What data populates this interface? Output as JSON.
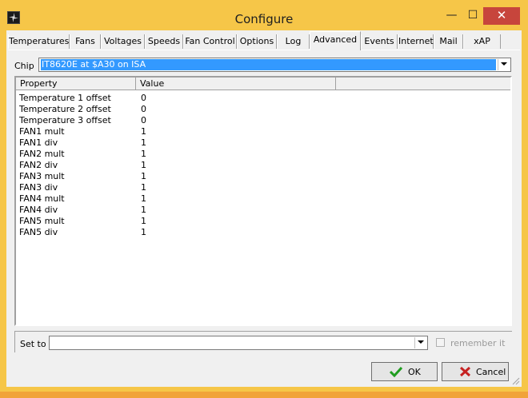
{
  "window": {
    "title": "Configure"
  },
  "caption_buttons": {
    "minimize": "—",
    "maximize": "☐",
    "close": "✕"
  },
  "tabs": [
    {
      "label": "Temperatures",
      "active": false
    },
    {
      "label": "Fans",
      "active": false
    },
    {
      "label": "Voltages",
      "active": false
    },
    {
      "label": "Speeds",
      "active": false
    },
    {
      "label": "Fan Control",
      "active": false
    },
    {
      "label": "Options",
      "active": false
    },
    {
      "label": "Log",
      "active": false
    },
    {
      "label": "Advanced",
      "active": true
    },
    {
      "label": "Events",
      "active": false
    },
    {
      "label": "Internet",
      "active": false
    },
    {
      "label": "Mail",
      "active": false
    },
    {
      "label": "xAP",
      "active": false
    }
  ],
  "chip": {
    "label": "Chip",
    "value": "IT8620E at $A30 on ISA"
  },
  "table": {
    "columns": [
      "Property",
      "Value",
      ""
    ],
    "rows": [
      [
        "Temperature 1 offset",
        "0"
      ],
      [
        "Temperature 2 offset",
        "0"
      ],
      [
        "Temperature 3 offset",
        "0"
      ],
      [
        "FAN1 mult",
        "1"
      ],
      [
        "FAN1 div",
        "1"
      ],
      [
        "FAN2 mult",
        "1"
      ],
      [
        "FAN2 div",
        "1"
      ],
      [
        "FAN3 mult",
        "1"
      ],
      [
        "FAN3 div",
        "1"
      ],
      [
        "FAN4 mult",
        "1"
      ],
      [
        "FAN4 div",
        "1"
      ],
      [
        "FAN5 mult",
        "1"
      ],
      [
        "FAN5 div",
        "1"
      ]
    ]
  },
  "set_to": {
    "label": "Set to",
    "value": "",
    "remember_label": "remember it",
    "remember_checked": false
  },
  "buttons": {
    "ok": "OK",
    "cancel": "Cancel"
  },
  "colors": {
    "title_bar": "#f6c648",
    "close_button": "#c7453c",
    "selection": "#3399ff",
    "ok_icon": "#1f9d1f",
    "cancel_icon": "#c62222"
  }
}
